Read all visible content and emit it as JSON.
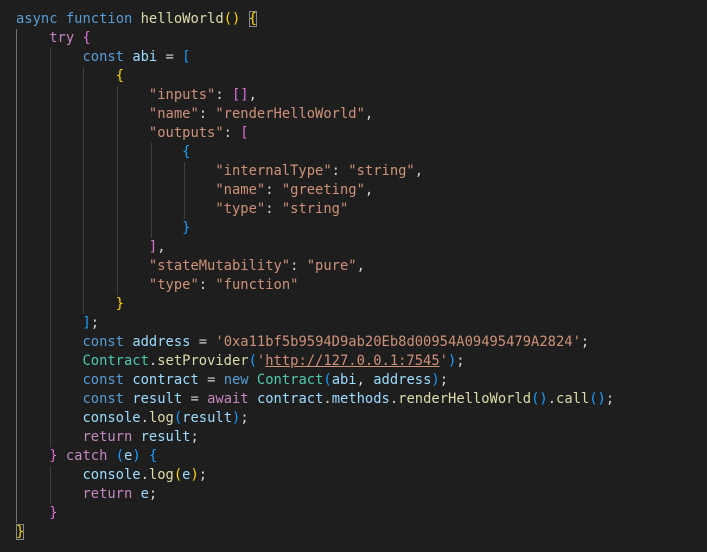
{
  "theme": {
    "background": "#1e1e1e",
    "keyword": "#569cd6",
    "control": "#c586c0",
    "function": "#dcdcaa",
    "variable": "#9cdcfe",
    "string": "#ce9178",
    "class": "#4ec9b0",
    "punctuation": "#d4d4d4",
    "bracket_gold": "#ffd700",
    "bracket_purple": "#da70d6",
    "bracket_blue": "#179fff"
  },
  "code_lines": [
    [
      [
        "async",
        "keyword"
      ],
      [
        " ",
        "plain"
      ],
      [
        "function",
        "keyword"
      ],
      [
        " ",
        "plain"
      ],
      [
        "helloWorld",
        "function"
      ],
      [
        "()",
        "gold"
      ],
      [
        " ",
        "plain"
      ],
      [
        "{",
        "gold",
        "brace-match"
      ]
    ],
    [
      [
        "try",
        "control"
      ],
      [
        " ",
        "plain"
      ],
      [
        "{",
        "purple"
      ]
    ],
    [
      [
        "const",
        "keyword"
      ],
      [
        " ",
        "plain"
      ],
      [
        "abi",
        "variable"
      ],
      [
        " = ",
        "punctuation"
      ],
      [
        "[",
        "blue"
      ]
    ],
    [
      [
        "{",
        "gold"
      ]
    ],
    [
      [
        "\"inputs\"",
        "string"
      ],
      [
        ": ",
        "punctuation"
      ],
      [
        "[]",
        "purple"
      ],
      [
        ",",
        "punctuation"
      ]
    ],
    [
      [
        "\"name\"",
        "string"
      ],
      [
        ": ",
        "punctuation"
      ],
      [
        "\"renderHelloWorld\"",
        "string"
      ],
      [
        ",",
        "punctuation"
      ]
    ],
    [
      [
        "\"outputs\"",
        "string"
      ],
      [
        ": ",
        "punctuation"
      ],
      [
        "[",
        "purple"
      ]
    ],
    [
      [
        "{",
        "blue"
      ]
    ],
    [
      [
        "\"internalType\"",
        "string"
      ],
      [
        ": ",
        "punctuation"
      ],
      [
        "\"string\"",
        "string"
      ],
      [
        ",",
        "punctuation"
      ]
    ],
    [
      [
        "\"name\"",
        "string"
      ],
      [
        ": ",
        "punctuation"
      ],
      [
        "\"greeting\"",
        "string"
      ],
      [
        ",",
        "punctuation"
      ]
    ],
    [
      [
        "\"type\"",
        "string"
      ],
      [
        ": ",
        "punctuation"
      ],
      [
        "\"string\"",
        "string"
      ]
    ],
    [
      [
        "}",
        "blue"
      ]
    ],
    [
      [
        "]",
        "purple"
      ],
      [
        ",",
        "punctuation"
      ]
    ],
    [
      [
        "\"stateMutability\"",
        "string"
      ],
      [
        ": ",
        "punctuation"
      ],
      [
        "\"pure\"",
        "string"
      ],
      [
        ",",
        "punctuation"
      ]
    ],
    [
      [
        "\"type\"",
        "string"
      ],
      [
        ": ",
        "punctuation"
      ],
      [
        "\"function\"",
        "string"
      ]
    ],
    [
      [
        "}",
        "gold"
      ]
    ],
    [
      [
        "]",
        "blue"
      ],
      [
        ";",
        "punctuation"
      ]
    ],
    [
      [
        "const",
        "keyword"
      ],
      [
        " ",
        "plain"
      ],
      [
        "address",
        "variable"
      ],
      [
        " = ",
        "punctuation"
      ],
      [
        "'0xa11bf5b9594D9ab20Eb8d00954A09495479A2824'",
        "string"
      ],
      [
        ";",
        "punctuation"
      ]
    ],
    [
      [
        "Contract",
        "class"
      ],
      [
        ".",
        "punctuation"
      ],
      [
        "setProvider",
        "function"
      ],
      [
        "(",
        "blue"
      ],
      [
        "'",
        "string"
      ],
      [
        "http://127.0.0.1:7545",
        "string",
        "link"
      ],
      [
        "'",
        "string"
      ],
      [
        ")",
        "blue"
      ],
      [
        ";",
        "punctuation"
      ]
    ],
    [
      [
        "const",
        "keyword"
      ],
      [
        " ",
        "plain"
      ],
      [
        "contract",
        "variable"
      ],
      [
        " = ",
        "punctuation"
      ],
      [
        "new",
        "keyword"
      ],
      [
        " ",
        "plain"
      ],
      [
        "Contract",
        "class"
      ],
      [
        "(",
        "blue"
      ],
      [
        "abi",
        "variable"
      ],
      [
        ", ",
        "punctuation"
      ],
      [
        "address",
        "variable"
      ],
      [
        ")",
        "blue"
      ],
      [
        ";",
        "punctuation"
      ]
    ],
    [
      [
        "const",
        "keyword"
      ],
      [
        " ",
        "plain"
      ],
      [
        "result",
        "variable"
      ],
      [
        " = ",
        "punctuation"
      ],
      [
        "await",
        "control"
      ],
      [
        " ",
        "plain"
      ],
      [
        "contract",
        "variable"
      ],
      [
        ".",
        "punctuation"
      ],
      [
        "methods",
        "variable"
      ],
      [
        ".",
        "punctuation"
      ],
      [
        "renderHelloWorld",
        "function"
      ],
      [
        "()",
        "blue"
      ],
      [
        ".",
        "punctuation"
      ],
      [
        "call",
        "function"
      ],
      [
        "()",
        "blue"
      ],
      [
        ";",
        "punctuation"
      ]
    ],
    [
      [
        "console",
        "variable"
      ],
      [
        ".",
        "punctuation"
      ],
      [
        "log",
        "function"
      ],
      [
        "(",
        "blue"
      ],
      [
        "result",
        "variable"
      ],
      [
        ")",
        "blue"
      ],
      [
        ";",
        "punctuation"
      ]
    ],
    [
      [
        "return",
        "control"
      ],
      [
        " ",
        "plain"
      ],
      [
        "result",
        "variable"
      ],
      [
        ";",
        "punctuation"
      ]
    ],
    [
      [
        "}",
        "purple"
      ],
      [
        " ",
        "plain"
      ],
      [
        "catch",
        "control"
      ],
      [
        " ",
        "plain"
      ],
      [
        "(",
        "blue"
      ],
      [
        "e",
        "variable"
      ],
      [
        ")",
        "blue"
      ],
      [
        " ",
        "plain"
      ],
      [
        "{",
        "blue"
      ]
    ],
    [
      [
        "console",
        "variable"
      ],
      [
        ".",
        "punctuation"
      ],
      [
        "log",
        "function"
      ],
      [
        "(",
        "gold"
      ],
      [
        "e",
        "variable"
      ],
      [
        ")",
        "gold"
      ],
      [
        ";",
        "punctuation"
      ]
    ],
    [
      [
        "return",
        "control"
      ],
      [
        " ",
        "plain"
      ],
      [
        "e",
        "variable"
      ],
      [
        ";",
        "punctuation"
      ]
    ],
    [
      [
        "}",
        "purple"
      ]
    ],
    [
      [
        "}",
        "gold",
        "brace-match"
      ]
    ]
  ]
}
